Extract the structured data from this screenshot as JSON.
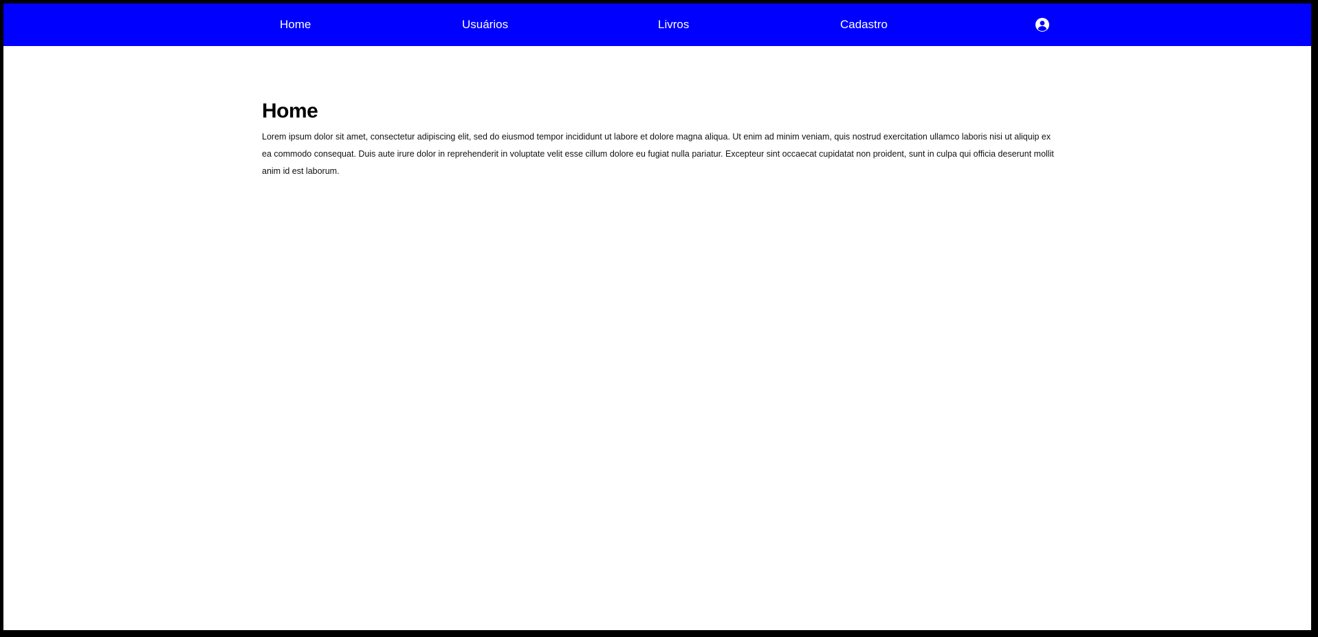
{
  "nav": {
    "items": [
      {
        "label": "Home"
      },
      {
        "label": "Usuários"
      },
      {
        "label": "Livros"
      },
      {
        "label": "Cadastro"
      }
    ],
    "profile_icon": "user-circle-icon"
  },
  "main": {
    "title": "Home",
    "text": "Lorem ipsum dolor sit amet, consectetur adipiscing elit, sed do eiusmod tempor incididunt ut labore et dolore magna aliqua. Ut enim ad minim veniam, quis nostrud exercitation ullamco laboris nisi ut aliquip ex ea commodo consequat. Duis aute irure dolor in reprehenderit in voluptate velit esse cillum dolore eu fugiat nulla pariatur. Excepteur sint occaecat cupidatat non proident, sunt in culpa qui officia deserunt mollit anim id est laborum."
  },
  "colors": {
    "navbar": "#0000ff",
    "nav_text": "#ffffff",
    "background": "#ffffff",
    "border": "#000000"
  }
}
